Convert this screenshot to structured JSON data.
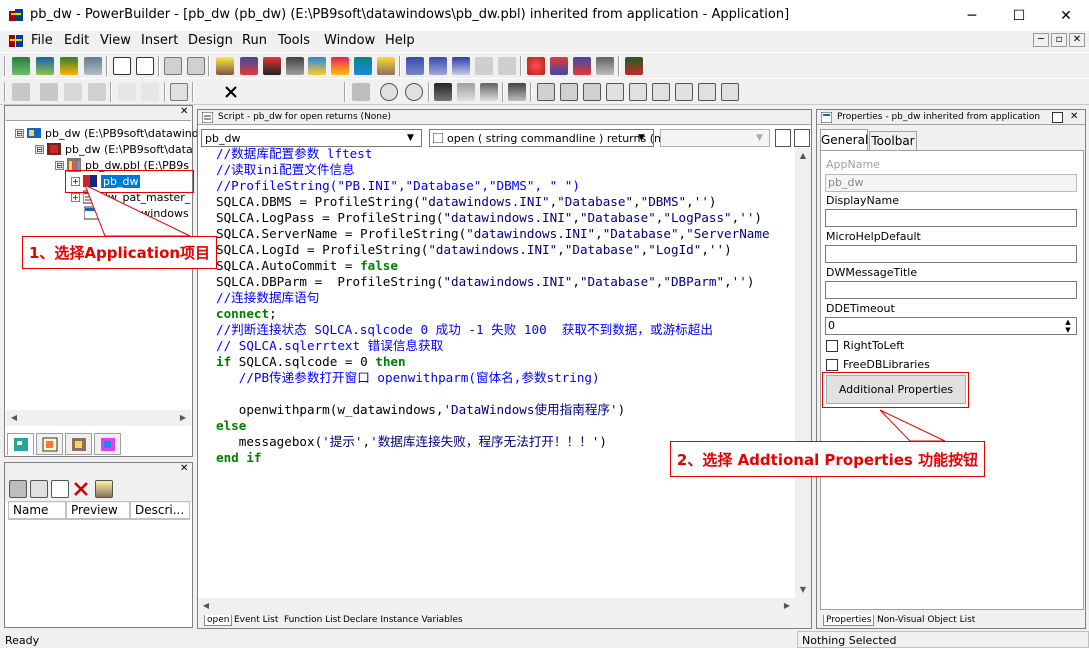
{
  "window": {
    "title": "pb_dw - PowerBuilder - [pb_dw (pb_dw) (E:\\PB9soft\\datawindows\\pb_dw.pbl) inherited from application - Application]",
    "minimize": "─",
    "maximize": "☐",
    "close": "✕"
  },
  "menu": [
    "File",
    "Edit",
    "View",
    "Insert",
    "Design",
    "Run",
    "Tools",
    "Window",
    "Help"
  ],
  "mdi_controls": [
    "─",
    "▫",
    "✕"
  ],
  "tree": {
    "close": "✕",
    "nodes": [
      {
        "label": "pb_dw (E:\\PB9soft\\datawind",
        "exp": "⊟"
      },
      {
        "label": "pb_dw (E:\\PB9soft\\data",
        "exp": "⊟"
      },
      {
        "label": "pb_dw.pbl (E:\\PB9s",
        "exp": "⊟"
      },
      {
        "label": "pb_dw",
        "exp": "+"
      },
      {
        "label": "dw_pat_master_",
        "exp": "+"
      },
      {
        "label": "w_datawindows",
        "exp": ""
      }
    ]
  },
  "lower_panel": {
    "close": "✕",
    "columns": [
      "Name",
      "Preview",
      "Descri..."
    ]
  },
  "script": {
    "title": "Script - pb_dw for open returns (None)",
    "object_dropdown": "pb_dw",
    "event_dropdown": "open ( string commandline ) returns (non",
    "lines": [
      [
        {
          "t": "//数据库配置参数 lftest",
          "c": "com"
        }
      ],
      [
        {
          "t": "//读取ini配置文件信息",
          "c": "com"
        }
      ],
      [
        {
          "t": "//ProfileString(\"PB.INI\",\"Database\",\"DBMS\", \" \")",
          "c": "com"
        }
      ],
      [
        {
          "t": "SQLCA.DBMS = ProfileString(",
          "c": "blk"
        },
        {
          "t": "\"datawindows.INI\"",
          "c": "str"
        },
        {
          "t": ",",
          "c": "blk"
        },
        {
          "t": "\"Database\"",
          "c": "str"
        },
        {
          "t": ",",
          "c": "blk"
        },
        {
          "t": "\"DBMS\"",
          "c": "str"
        },
        {
          "t": ",",
          "c": "blk"
        },
        {
          "t": "''",
          "c": "str"
        },
        {
          "t": ")",
          "c": "blk"
        }
      ],
      [
        {
          "t": "SQLCA.LogPass = ProfileString(",
          "c": "blk"
        },
        {
          "t": "\"datawindows.INI\"",
          "c": "str"
        },
        {
          "t": ",",
          "c": "blk"
        },
        {
          "t": "\"Database\"",
          "c": "str"
        },
        {
          "t": ",",
          "c": "blk"
        },
        {
          "t": "\"LogPass\"",
          "c": "str"
        },
        {
          "t": ",",
          "c": "blk"
        },
        {
          "t": "''",
          "c": "str"
        },
        {
          "t": ")",
          "c": "blk"
        }
      ],
      [
        {
          "t": "SQLCA.ServerName = ProfileString(",
          "c": "blk"
        },
        {
          "t": "\"datawindows.INI\"",
          "c": "str"
        },
        {
          "t": ",",
          "c": "blk"
        },
        {
          "t": "\"Database\"",
          "c": "str"
        },
        {
          "t": ",",
          "c": "blk"
        },
        {
          "t": "\"ServerName",
          "c": "str"
        }
      ],
      [
        {
          "t": "SQLCA.LogId = ProfileString(",
          "c": "blk"
        },
        {
          "t": "\"datawindows.INI\"",
          "c": "str"
        },
        {
          "t": ",",
          "c": "blk"
        },
        {
          "t": "\"Database\"",
          "c": "str"
        },
        {
          "t": ",",
          "c": "blk"
        },
        {
          "t": "\"LogId\"",
          "c": "str"
        },
        {
          "t": ",",
          "c": "blk"
        },
        {
          "t": "''",
          "c": "str"
        },
        {
          "t": ")",
          "c": "blk"
        }
      ],
      [
        {
          "t": "SQLCA.AutoCommit = ",
          "c": "blk"
        },
        {
          "t": "false",
          "c": "kw"
        }
      ],
      [
        {
          "t": "SQLCA.DBParm =  ProfileString(",
          "c": "blk"
        },
        {
          "t": "\"datawindows.INI\"",
          "c": "str"
        },
        {
          "t": ",",
          "c": "blk"
        },
        {
          "t": "\"Database\"",
          "c": "str"
        },
        {
          "t": ",",
          "c": "blk"
        },
        {
          "t": "\"DBParm\"",
          "c": "str"
        },
        {
          "t": ",",
          "c": "blk"
        },
        {
          "t": "''",
          "c": "str"
        },
        {
          "t": ")",
          "c": "blk"
        }
      ],
      [
        {
          "t": "//连接数据库语句",
          "c": "com"
        }
      ],
      [
        {
          "t": "connect",
          "c": "kw"
        },
        {
          "t": ";",
          "c": "blk"
        }
      ],
      [
        {
          "t": "//判断连接状态 SQLCA.sqlcode 0 成功 -1 失败 100  获取不到数据，或游标超出",
          "c": "com"
        }
      ],
      [
        {
          "t": "// SQLCA.sqlerrtext 错误信息获取",
          "c": "com"
        }
      ],
      [
        {
          "t": "if",
          "c": "kw"
        },
        {
          "t": " SQLCA.sqlcode = ",
          "c": "blk"
        },
        {
          "t": "0",
          "c": "blk"
        },
        {
          "t": " then",
          "c": "kw"
        }
      ],
      [
        {
          "t": "   //PB传递参数打开窗口 openwithparm(窗体名,参数string)",
          "c": "com"
        }
      ],
      [
        {
          "t": "",
          "c": "blk"
        }
      ],
      [
        {
          "t": "   openwithparm(w_datawindows,",
          "c": "blk"
        },
        {
          "t": "'DataWindows使用指南程序'",
          "c": "str"
        },
        {
          "t": ")",
          "c": "blk"
        }
      ],
      [
        {
          "t": "else",
          "c": "kw"
        }
      ],
      [
        {
          "t": "   messagebox(",
          "c": "blk"
        },
        {
          "t": "'提示'",
          "c": "str"
        },
        {
          "t": ",",
          "c": "blk"
        },
        {
          "t": "'数据库连接失败，程序无法打开！！！'",
          "c": "str"
        },
        {
          "t": ")",
          "c": "blk"
        }
      ],
      [
        {
          "t": "end if",
          "c": "kw"
        }
      ]
    ],
    "bottom_tabs": [
      "open",
      "Event List",
      "Function List",
      "Declare Instance Variables"
    ]
  },
  "properties": {
    "title": "Properties - pb_dw  inherited  from  application",
    "tabs": [
      "General",
      "Toolbar"
    ],
    "appname_label": "AppName",
    "appname_value": "pb_dw",
    "displayname_label": "DisplayName",
    "microhelp_label": "MicroHelpDefault",
    "dwmessage_label": "DWMessageTitle",
    "ddetimeout_label": "DDETimeout",
    "ddetimeout_value": "0",
    "righttoleft_label": "RightToLeft",
    "freedb_label": "FreeDBLibraries",
    "additional_button": "Additional Properties",
    "bottom_tabs": [
      "Properties",
      "Non-Visual Object List"
    ]
  },
  "callouts": {
    "step1": "1、选择Application项目",
    "step2": "2、选择 Addtional Properties 功能按钮"
  },
  "status": {
    "left": "Ready",
    "right": "Nothing Selected"
  }
}
